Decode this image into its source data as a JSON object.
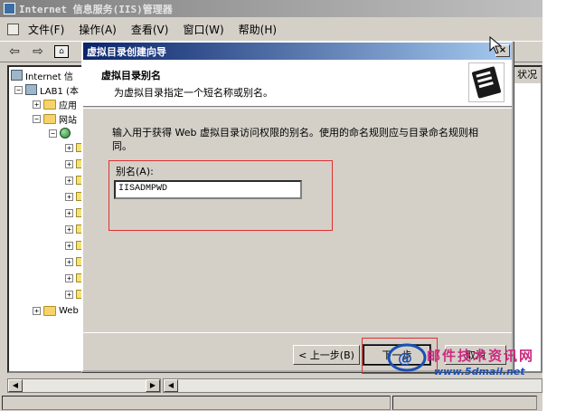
{
  "window": {
    "title": "Internet 信息服务(IIS)管理器"
  },
  "menu": [
    {
      "label": "文件(F)"
    },
    {
      "label": "操作(A)"
    },
    {
      "label": "查看(V)"
    },
    {
      "label": "窗口(W)"
    },
    {
      "label": "帮助(H)"
    }
  ],
  "tree": {
    "root": "Internet 信",
    "server": "LAB1 (本",
    "app_pools": "应用",
    "websites": "网站",
    "web_ext": "Web"
  },
  "right_pane": {
    "status_header": "状况"
  },
  "wizard": {
    "title": "虚拟目录创建向导",
    "header_title": "虚拟目录别名",
    "header_subtitle": "为虚拟目录指定一个短名称或别名。",
    "description": "输入用于获得 Web 虚拟目录访问权限的别名。使用的命名规则应与目录命名规则相同。",
    "alias_label": "别名(A):",
    "alias_value": "IISADMPWD",
    "back_label": "< 上一步(B)",
    "next_label": "下一步",
    "cancel_label": "取消",
    "close_glyph": "×"
  },
  "watermark": {
    "brand": "邮件技术资讯网",
    "url": "www.5dmail.net"
  },
  "colors": {
    "dialog_title_start": "#0a246a",
    "dialog_title_end": "#a6caf0",
    "highlight": "#e03030",
    "watermark_brand": "#cc2a80",
    "watermark_url": "#1b4fb3"
  }
}
